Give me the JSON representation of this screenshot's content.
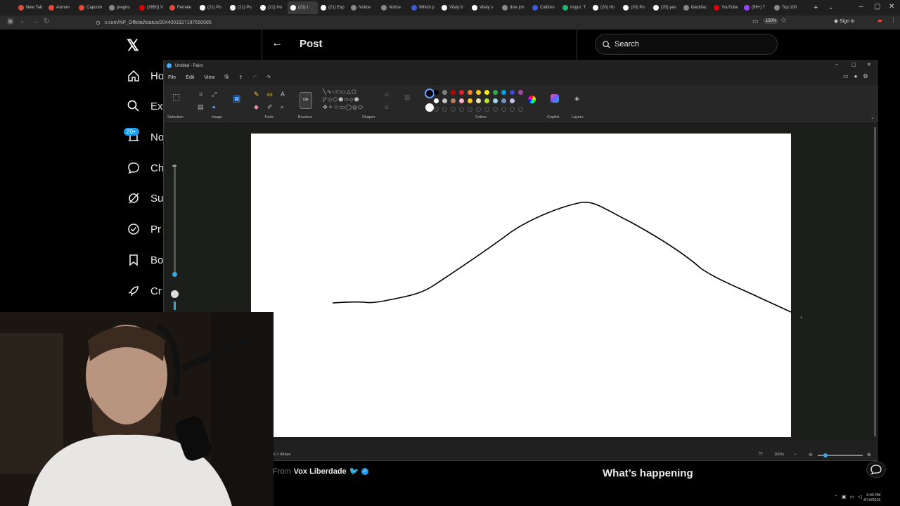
{
  "browser": {
    "tabs": [
      {
        "label": "New Tab",
        "color": "#e04a3b"
      },
      {
        "label": "Asmon",
        "color": "#e04a3b"
      },
      {
        "label": "Capcom",
        "color": "#e04a3b"
      },
      {
        "label": "pregnu",
        "color": "#888888"
      },
      {
        "label": "(3950) V",
        "color": "#e00000"
      },
      {
        "label": "Female",
        "color": "#e04a3b"
      },
      {
        "label": "(21) Po",
        "color": "#ffffff"
      },
      {
        "label": "(21) Po",
        "color": "#ffffff"
      },
      {
        "label": "(21) Ho",
        "color": "#ffffff"
      },
      {
        "label": "(21) I",
        "color": "#ffffff",
        "active": true
      },
      {
        "label": "(21) Exp",
        "color": "#ffffff"
      },
      {
        "label": "Notice",
        "color": "#888888"
      },
      {
        "label": "Notice",
        "color": "#888888"
      },
      {
        "label": "Which p",
        "color": "#3b5bdb"
      },
      {
        "label": "Vitaly b",
        "color": "#ffffff"
      },
      {
        "label": "Vitaly s",
        "color": "#ffffff"
      },
      {
        "label": "dow jon",
        "color": "#888888"
      },
      {
        "label": "Californ",
        "color": "#3b5bdb"
      },
      {
        "label": "Imgur: T",
        "color": "#1bb76e"
      },
      {
        "label": "(20) Ho",
        "color": "#ffffff"
      },
      {
        "label": "(20) Po",
        "color": "#ffffff"
      },
      {
        "label": "(20) yes",
        "color": "#ffffff"
      },
      {
        "label": "blackfac",
        "color": "#888888"
      },
      {
        "label": "YouTube",
        "color": "#e00000"
      },
      {
        "label": "(99+) T",
        "color": "#9146ff"
      },
      {
        "label": "Top 100",
        "color": "#888888"
      }
    ],
    "url": "x.com/NP_Official/status/2044001627187650985",
    "zoom": "150%",
    "signin_label": "Sign in"
  },
  "x": {
    "nav": [
      {
        "label": "Ho",
        "icon": "home-icon"
      },
      {
        "label": "Ex",
        "icon": "search-icon"
      },
      {
        "label": "No",
        "icon": "bell-icon"
      },
      {
        "label": "Ch",
        "icon": "chat-icon"
      },
      {
        "label": "Su",
        "icon": "grok-icon"
      },
      {
        "label": "Pr",
        "icon": "verified-icon"
      },
      {
        "label": "Bo",
        "icon": "bookmark-icon"
      },
      {
        "label": "Cr",
        "icon": "rocket-icon"
      }
    ],
    "notif_badge": "20+",
    "header_title": "Post",
    "search_placeholder": "Search",
    "from_prefix": "From",
    "from_author": "Vox Liberdade",
    "whats_happening": "What’s happening"
  },
  "paint": {
    "title": "Untitled - Paint",
    "menu": [
      "File",
      "Edit",
      "View"
    ],
    "ribbon_labels": {
      "selection": "Selection",
      "image": "Image",
      "tools": "Tools",
      "brushes": "Brushes",
      "shapes": "Shapes",
      "colors": "Colors",
      "copilot": "Copilot",
      "layers": "Layers"
    },
    "palette_row1": [
      "#000000",
      "#7f7f7f",
      "#c00000",
      "#ed1c24",
      "#ff7f27",
      "#ffc90e",
      "#fff200",
      "#22b14c",
      "#00a2e8",
      "#3f48cc",
      "#a349a4"
    ],
    "palette_row2": [
      "#ffffff",
      "#c3c3c3",
      "#b97a57",
      "#ffaec9",
      "#ffc90e",
      "#efe4b0",
      "#b5e61d",
      "#99d9ea",
      "#7092be",
      "#c8bfe7"
    ],
    "status_size": "6 × 864px",
    "zoom_level": "100%"
  },
  "taskbar": {
    "time": "4:00 PM",
    "date": "4/14/2026"
  }
}
